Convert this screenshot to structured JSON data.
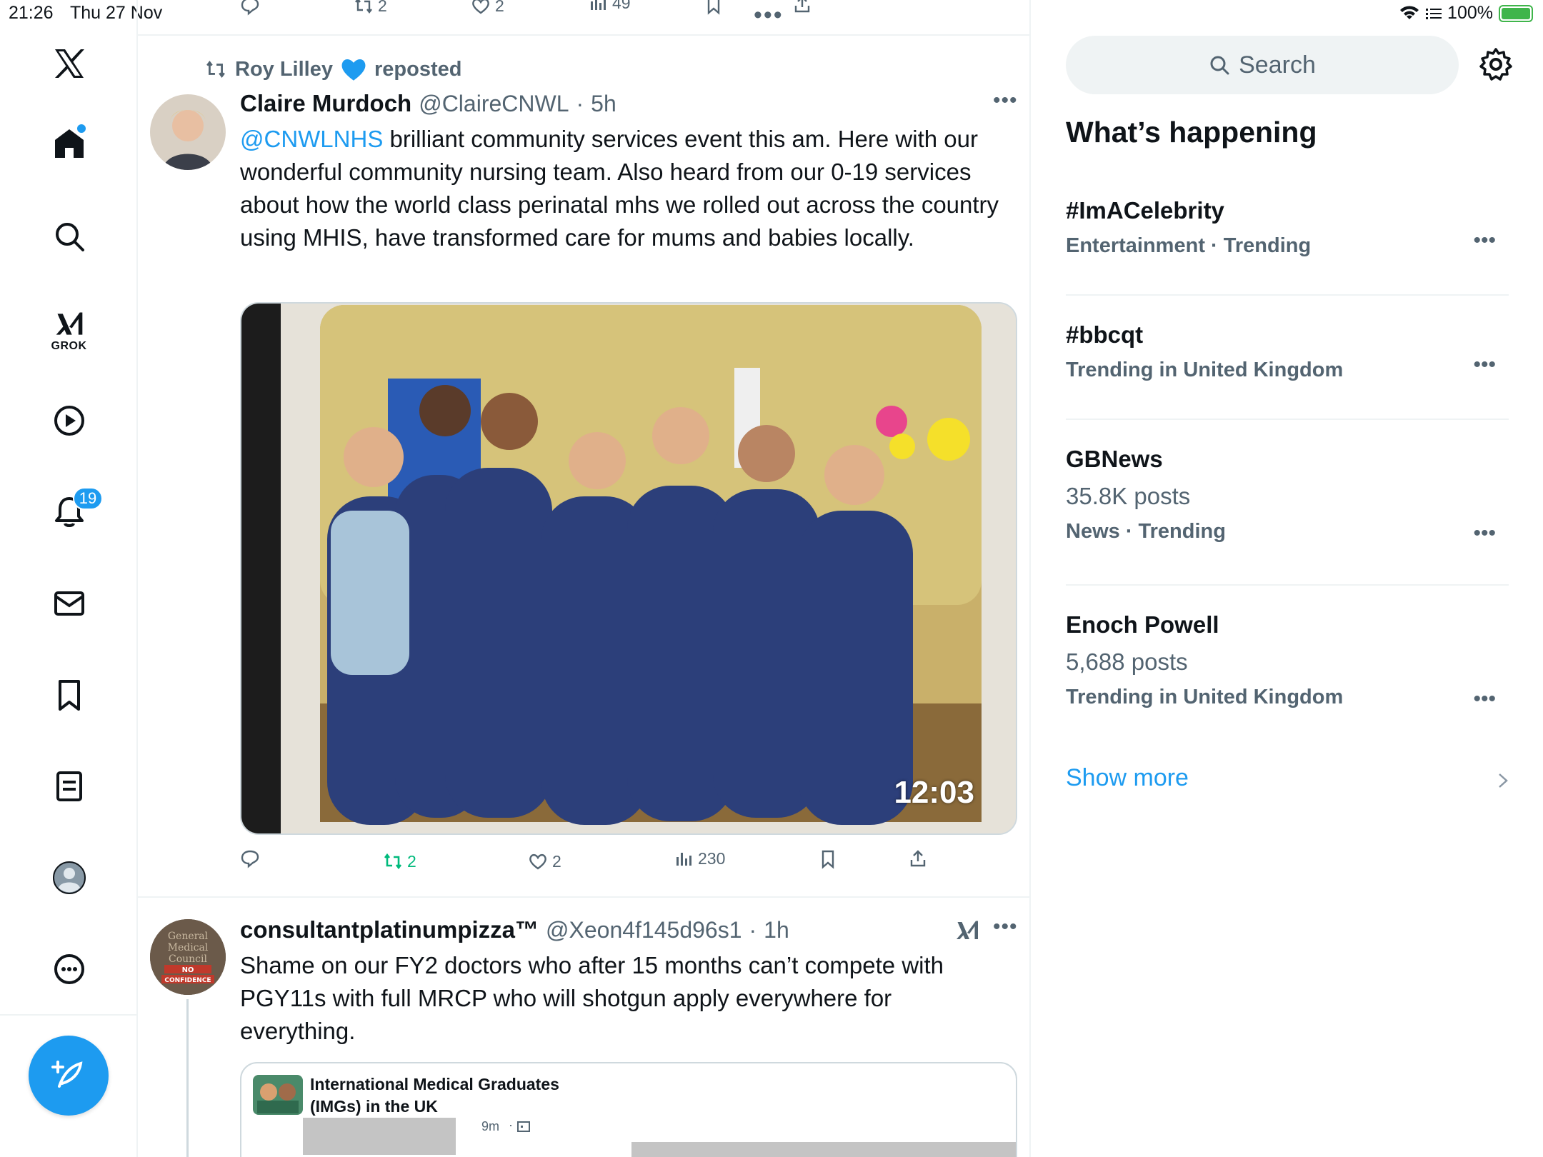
{
  "status_bar": {
    "time": "21:26",
    "date": "Thu 27 Nov",
    "battery": "100%"
  },
  "nav": {
    "notifications_badge": "19",
    "grok_label": "GROK"
  },
  "top_actions": {
    "retweets": "2",
    "likes": "2",
    "views": "49"
  },
  "tweet1": {
    "reposter": "Roy Lilley",
    "reposted_label": "reposted",
    "display_name": "Claire Murdoch",
    "handle": "@ClaireCNWL",
    "time": "5h",
    "mention": "@CNWLNHS",
    "text": " brilliant community services event this am. Here with our wonderful community nursing team. Also heard from our 0-19 services about how the world class perinatal mhs we rolled out across the country using MHIS, have transformed care for mums and babies locally.",
    "media_time": "12:03",
    "replies": "",
    "retweets": "2",
    "likes": "2",
    "views": "230"
  },
  "tweet2": {
    "display_name": "consultantplatinumpizza™",
    "handle": "@Xeon4f145d96s1",
    "time": "1h",
    "text": "Shame on our FY2 doctors who after 15 months can’t compete with PGY11s with full MRCP who will shotgun apply everywhere for everything.",
    "quote_title_1": "International Medical Graduates",
    "quote_title_2": "(IMGs) in the UK",
    "quote_time": "9m",
    "avatar_text_1": "General",
    "avatar_text_2": "Medical",
    "avatar_text_3": "Council",
    "avatar_text_4": "NO",
    "avatar_text_5": "CONFIDENCE"
  },
  "sidebar": {
    "search_placeholder": "Search",
    "section_title": "What’s happening",
    "trends": [
      {
        "name": "#ImACelebrity",
        "count": "",
        "meta": "Entertainment · Trending"
      },
      {
        "name": "#bbcqt",
        "count": "",
        "meta": "Trending in United Kingdom"
      },
      {
        "name": "GBNews",
        "count": "35.8K posts",
        "meta": "News · Trending"
      },
      {
        "name": "Enoch Powell",
        "count": "5,688 posts",
        "meta": "Trending in United Kingdom"
      }
    ],
    "show_more": "Show more"
  },
  "colors": {
    "accent": "#1d9bf0",
    "muted_text": "#536471",
    "retweet_green": "#00ba7c",
    "divider": "#eff3f4"
  },
  "icons": [
    "x-logo-icon",
    "home-icon",
    "search-icon",
    "grok-icon",
    "video-icon",
    "bell-icon",
    "mail-icon",
    "bookmark-icon",
    "list-icon",
    "profile-icon",
    "more-icon",
    "compose-icon",
    "reply-icon",
    "retweet-icon",
    "like-icon",
    "views-icon",
    "share-icon",
    "gear-icon",
    "chevron-right-icon",
    "wifi-icon",
    "battery-icon"
  ]
}
